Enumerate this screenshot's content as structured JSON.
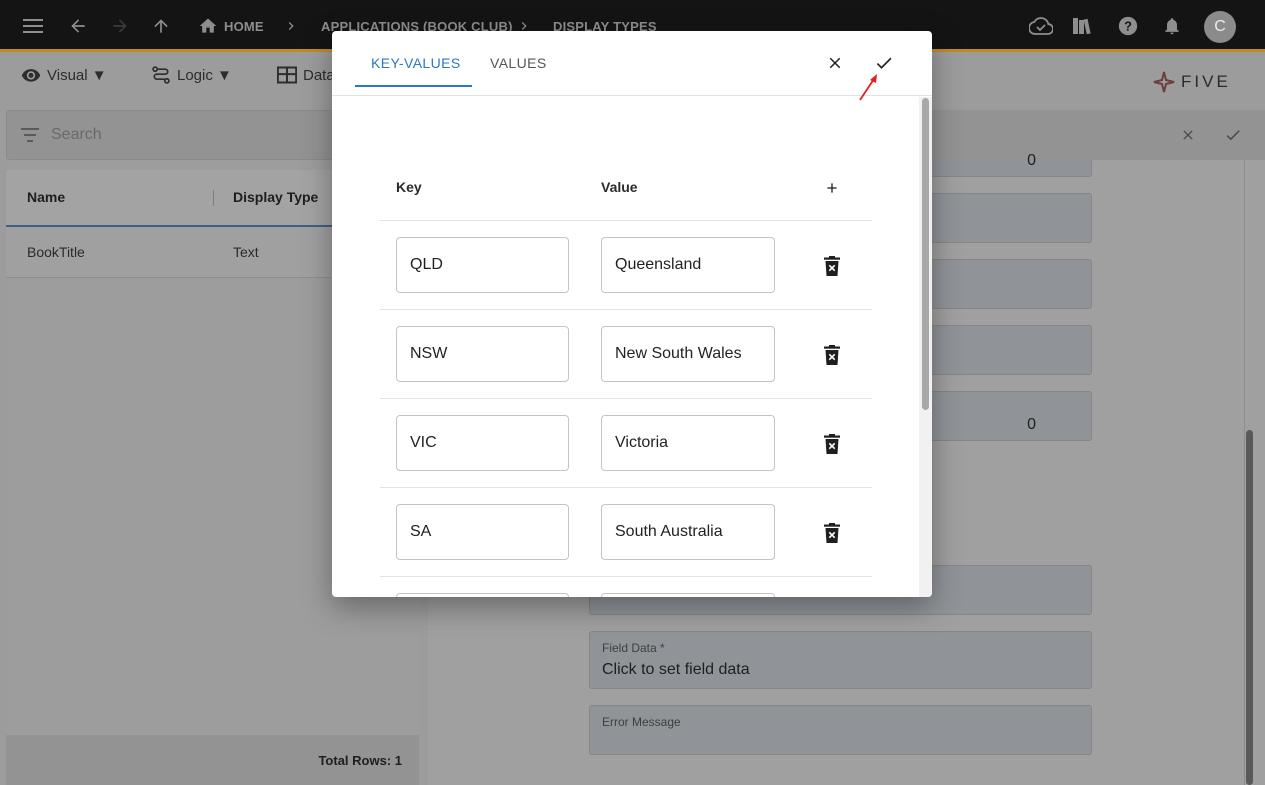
{
  "appbar": {
    "breadcrumb": {
      "home": "HOME",
      "application": "APPLICATIONS (BOOK CLUB)",
      "page": "DISPLAY TYPES"
    },
    "user_initial": "C"
  },
  "toolbar": {
    "visual": "Visual ▼",
    "logic": "Logic ▼",
    "data": "Data"
  },
  "logo": {
    "text": "FIVE"
  },
  "list": {
    "search_placeholder": "Search",
    "columns": [
      "Name",
      "Display Type"
    ],
    "rows": [
      {
        "name": "BookTitle",
        "display_type": "Text"
      }
    ],
    "total_rows": "Total Rows: 1"
  },
  "form": {
    "values": [
      "0",
      "0"
    ],
    "field_data": {
      "label": "Field Data *",
      "value": "Click to set field data"
    },
    "error_message": {
      "label": "Error Message"
    }
  },
  "modal": {
    "tabs": [
      "KEY-VALUES",
      "VALUES"
    ],
    "active_tab": "KEY-VALUES",
    "columns": {
      "key": "Key",
      "value": "Value"
    },
    "rows": [
      {
        "key": "QLD",
        "value": "Queensland"
      },
      {
        "key": "NSW",
        "value": "New South Wales"
      },
      {
        "key": "VIC",
        "value": "Victoria"
      },
      {
        "key": "SA",
        "value": "South Australia"
      }
    ]
  },
  "colors": {
    "accent": "#2b78c5",
    "appbar": "#141414",
    "appbar_border": "#c48a1d",
    "annotation_arrow": "#e02020"
  }
}
